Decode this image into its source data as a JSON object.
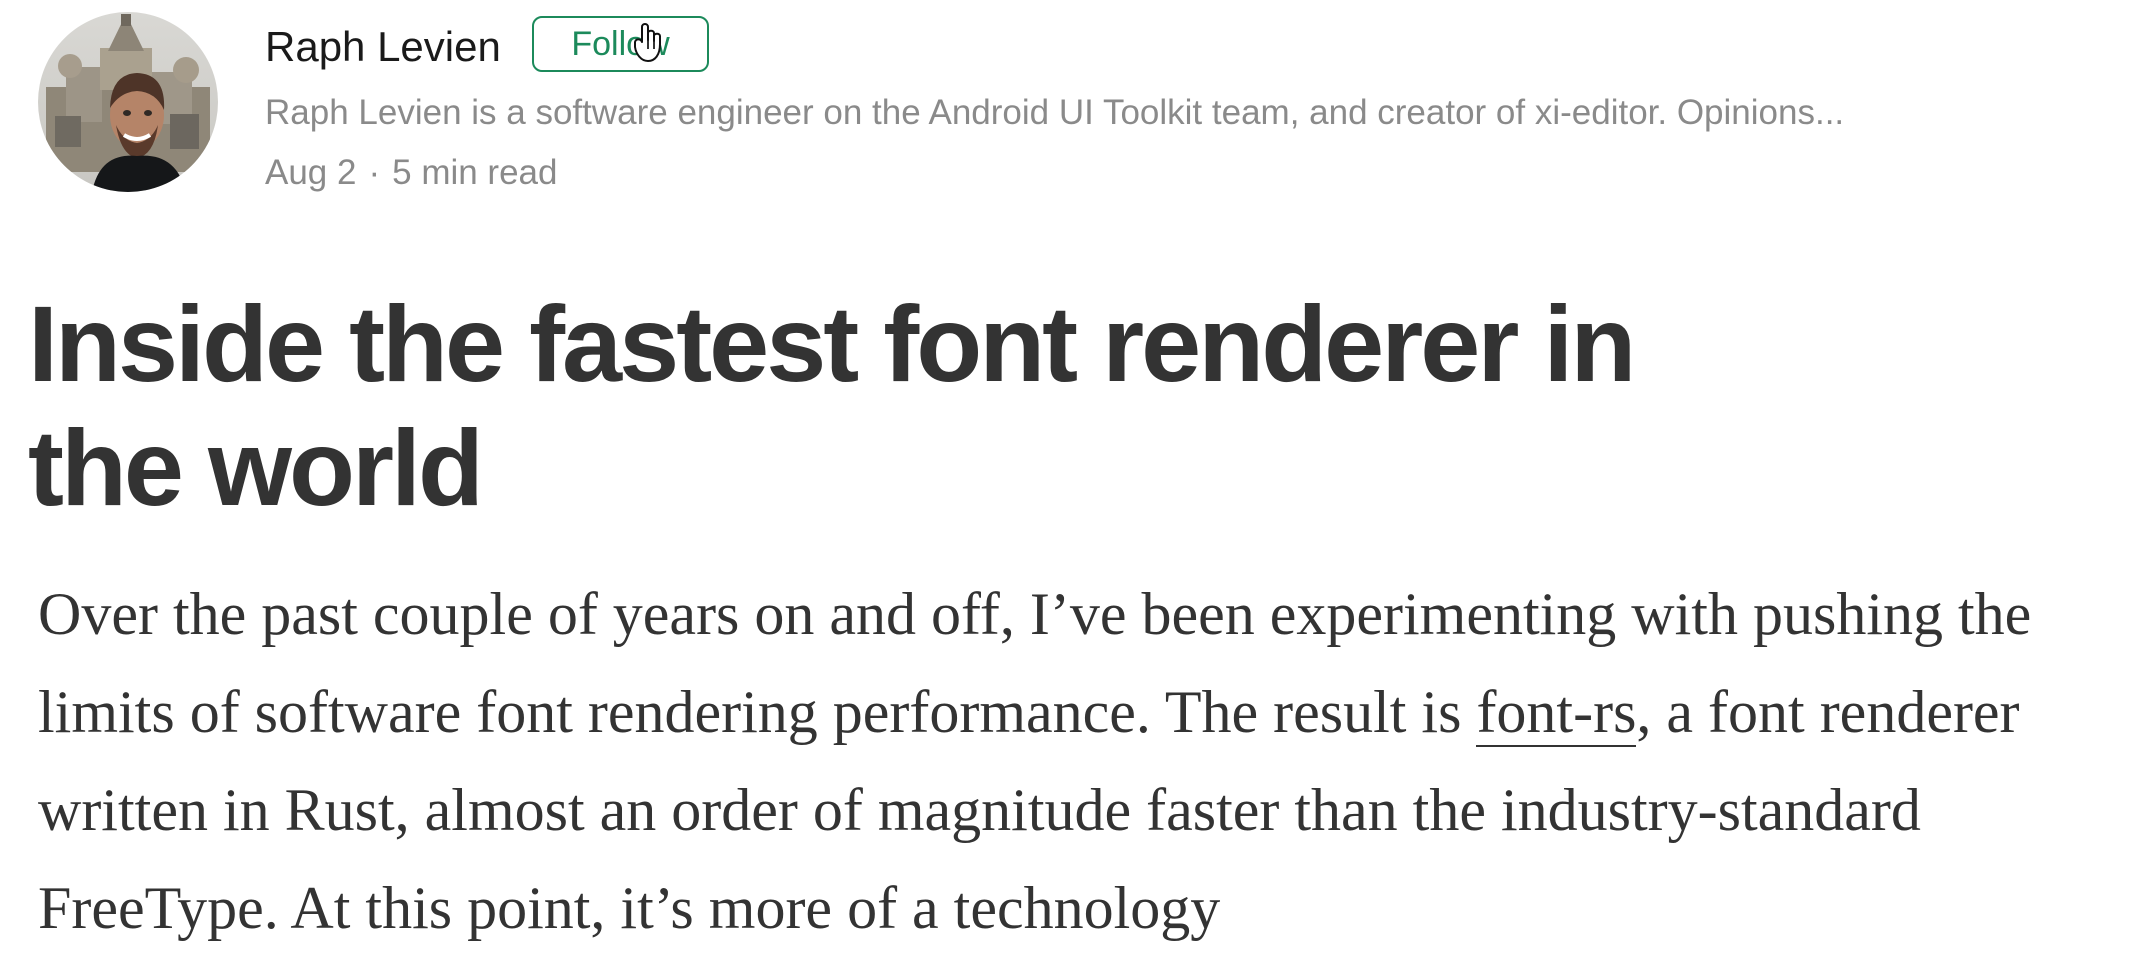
{
  "author": {
    "name": "Raph Levien",
    "follow_label": "Follow",
    "bio": "Raph Levien is a software engineer on the Android UI Toolkit team, and creator of xi-editor. Opinions..."
  },
  "post": {
    "date": "Aug 2",
    "separator": "·",
    "read_time": "5 min read",
    "title": "Inside the fastest font renderer in the world",
    "body_before_link": "Over the past couple of years on and off, I’ve been experimenting with pushing the limits of software font rendering performance. The result is ",
    "link_text": "font-rs",
    "body_after_link": ", a font renderer written in Rust, almost an order of magnitude faster than the industry-standard FreeType. At this point, it’s more of a technology"
  },
  "colors": {
    "accent": "#1c8a5b",
    "text": "#333333",
    "muted": "#8a8a8a"
  },
  "icons": {
    "avatar": "author-avatar",
    "cursor": "hand-pointer-icon"
  }
}
